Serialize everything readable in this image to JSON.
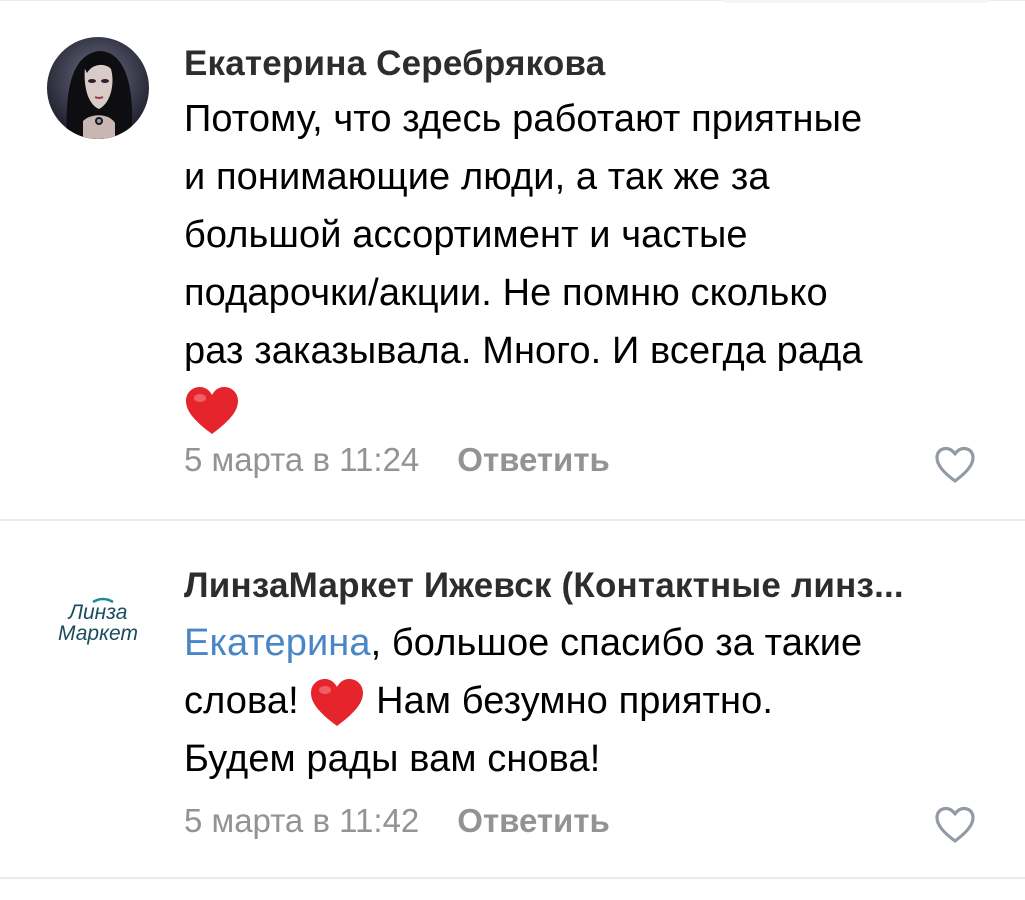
{
  "comments": [
    {
      "author": "Екатерина Серебрякова",
      "text_lines": [
        "Потому, что здесь работают приятные",
        "и понимающие люди, а так же за",
        "большой ассортимент и частые",
        "подарочки/акции. Не помню сколько",
        "раз заказывала. Много. И всегда рада"
      ],
      "emoji": "heart-emoji",
      "date": "5 марта в 11:24",
      "reply_label": "Ответить"
    },
    {
      "author": "ЛинзаМаркет Ижевск (Контактные линз...",
      "avatar_logo_line1": "Линза",
      "avatar_logo_line2": "Маркет",
      "mention": "Екатерина",
      "text_line1_rest": ", большое спасибо за такие",
      "text_line2_start": "слова! ",
      "text_line2_end": " Нам безумно приятно.",
      "text_line3": "Будем рады вам снова!",
      "emoji": "heart-emoji",
      "date": "5 марта в 11:42",
      "reply_label": "Ответить"
    }
  ],
  "colors": {
    "mention": "#4a86c6",
    "meta": "#939393",
    "heart": "#e5242c",
    "logo_teal": "#1f8a9a"
  }
}
